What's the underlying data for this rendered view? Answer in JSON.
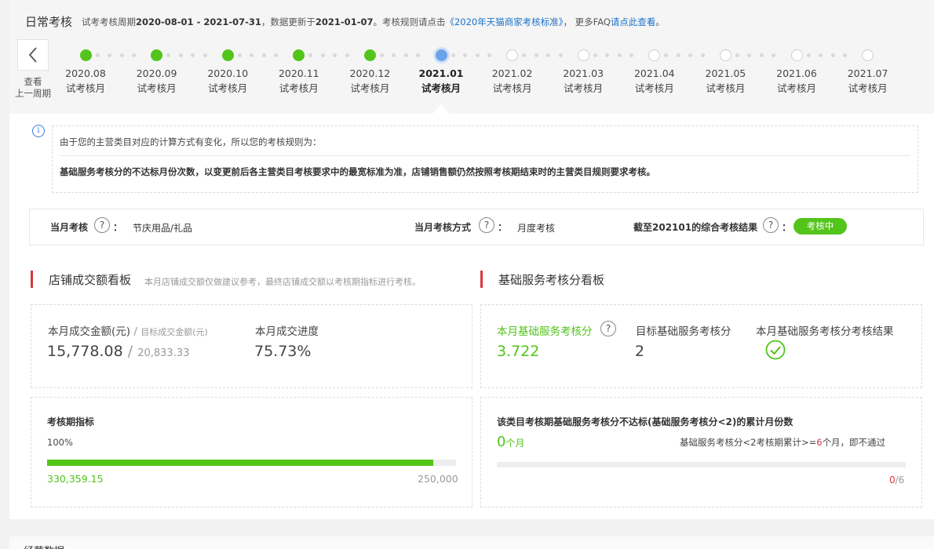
{
  "header": {
    "title": "日常考核",
    "desc_prefix": "试考考核周期",
    "period": "2020-08-01 - 2021-07-31",
    "desc_mid": "，数据更新于",
    "update_date": "2021-01-07",
    "desc_rule": "。考核规则请点击",
    "rule_link": "《2020年天猫商家考核标准》",
    "desc_faq": "，  更多FAQ",
    "faq_link": "请点此查看",
    "desc_end": "。"
  },
  "nav": {
    "prev_line1": "查看",
    "prev_line2": "上一周期"
  },
  "timeline": [
    {
      "month": "2020.08",
      "label": "试考核月",
      "state": "done"
    },
    {
      "month": "2020.09",
      "label": "试考核月",
      "state": "done"
    },
    {
      "month": "2020.10",
      "label": "试考核月",
      "state": "done"
    },
    {
      "month": "2020.11",
      "label": "试考核月",
      "state": "done"
    },
    {
      "month": "2020.12",
      "label": "试考核月",
      "state": "done"
    },
    {
      "month": "2021.01",
      "label": "试考核月",
      "state": "current"
    },
    {
      "month": "2021.02",
      "label": "试考核月",
      "state": "future"
    },
    {
      "month": "2021.03",
      "label": "试考核月",
      "state": "future"
    },
    {
      "month": "2021.04",
      "label": "试考核月",
      "state": "future"
    },
    {
      "month": "2021.05",
      "label": "试考核月",
      "state": "future"
    },
    {
      "month": "2021.06",
      "label": "试考核月",
      "state": "future"
    },
    {
      "month": "2021.07",
      "label": "试考核月",
      "state": "future"
    }
  ],
  "notice": {
    "line1": "由于您的主营类目对应的计算方式有变化，所以您的考核规则为：",
    "line2": "基础服务考核分的不达标月份次数，以变更前后各主营类目考核要求中的最宽标准为准，店铺销售额仍然按照考核期结束时的主营类目规则要求考核。"
  },
  "month_bar": {
    "assess_label": "当月考核",
    "assess_value": "节庆用品/礼品",
    "method_label": "当月考核方式",
    "method_value": "月度考核",
    "result_label": "截至202101的综合考核结果",
    "result_badge": "考核中",
    "colon": "：",
    "help": "?"
  },
  "left_board": {
    "title": "店铺成交额看板",
    "note": "本月店铺成交额仅做建议参考，最终店铺成交额以考核期指标进行考核。",
    "amount_label": "本月成交金额(元)",
    "slash": "/",
    "target_label": "目标成交金额(元)",
    "amount_value": "15,778.08",
    "target_value": "20,833.33",
    "progress_label": "本月成交进度",
    "progress_value": "75.73%",
    "indicator_title": "考核期指标",
    "indicator_percent": "100%",
    "indicator_fill": 0.945,
    "indicator_actual": "330,359.15",
    "indicator_target": "250,000"
  },
  "right_board": {
    "title": "基础服务考核分看板",
    "score_label": "本月基础服务考核分",
    "score_value": "3.722",
    "target_label": "目标基础服务考核分",
    "target_value": "2",
    "result_label": "本月基础服务考核分考核结果",
    "fail_title": "该类目考核期基础服务考核分不达标(基础服务考核分<2)的累计月份数",
    "fail_count": "0",
    "fail_unit": "个月",
    "rule_prefix": "基础服务考核分<2考核期累计>=",
    "rule_num": "6",
    "rule_suffix": "个月，即不通过",
    "ratio_num": "0",
    "ratio_den": "/6"
  },
  "footer": {
    "next_section": "经营数据"
  },
  "colors": {
    "green": "#52c41a",
    "accent_red": "#d9363e",
    "link_blue": "#1a73c9",
    "current_blue": "#6aa3e8"
  },
  "icons": {
    "prev": "chevron-left-icon",
    "info": "info-icon",
    "help": "question-circle-icon",
    "pass": "check-circle-icon"
  }
}
